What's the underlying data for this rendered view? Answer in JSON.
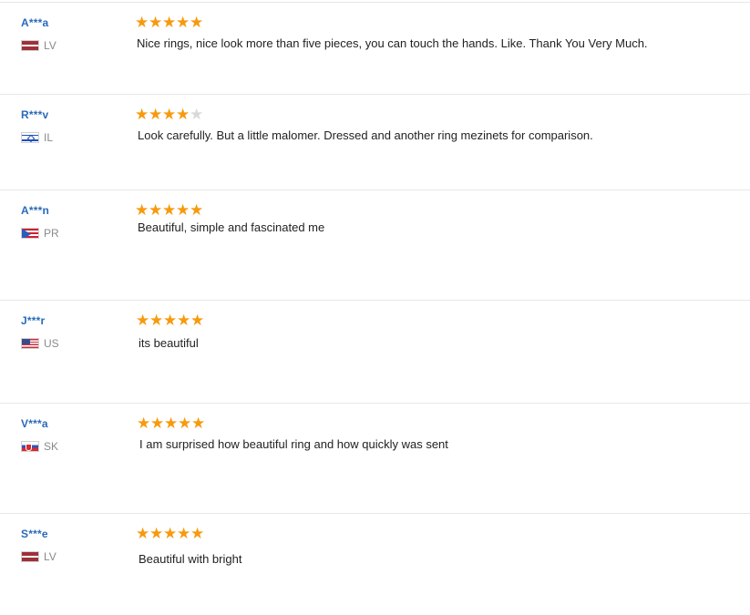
{
  "reviews": [
    {
      "buyer": "A***a",
      "country": "LV",
      "flag_icon": "latvia-flag-icon",
      "rating": 5,
      "text": "Nice rings, nice look more than five pieces, you can touch the hands. Like. Thank You Very Much."
    },
    {
      "buyer": "R***v",
      "country": "IL",
      "flag_icon": "israel-flag-icon",
      "rating": 4,
      "text": "Look carefully. But a little malomer. Dressed and another ring mezinets for comparison."
    },
    {
      "buyer": "A***n",
      "country": "PR",
      "flag_icon": "puerto-rico-flag-icon",
      "rating": 5,
      "text": "Beautiful, simple and fascinated me"
    },
    {
      "buyer": "J***r",
      "country": "US",
      "flag_icon": "usa-flag-icon",
      "rating": 5,
      "text": "its beautiful"
    },
    {
      "buyer": "V***a",
      "country": "SK",
      "flag_icon": "slovakia-flag-icon",
      "rating": 5,
      "text": "I am surprised how beautiful ring and how quickly was sent"
    },
    {
      "buyer": "S***e",
      "country": "LV",
      "flag_icon": "latvia-flag-icon",
      "rating": 5,
      "text": "Beautiful with bright"
    }
  ],
  "colors": {
    "buyer_name": "#2a6ab8",
    "star_filled": "#f79a0e",
    "star_empty": "#d9d9d9",
    "country_code": "#8a8a8a",
    "review_text": "#222222",
    "divider": "#e8e8e8"
  }
}
